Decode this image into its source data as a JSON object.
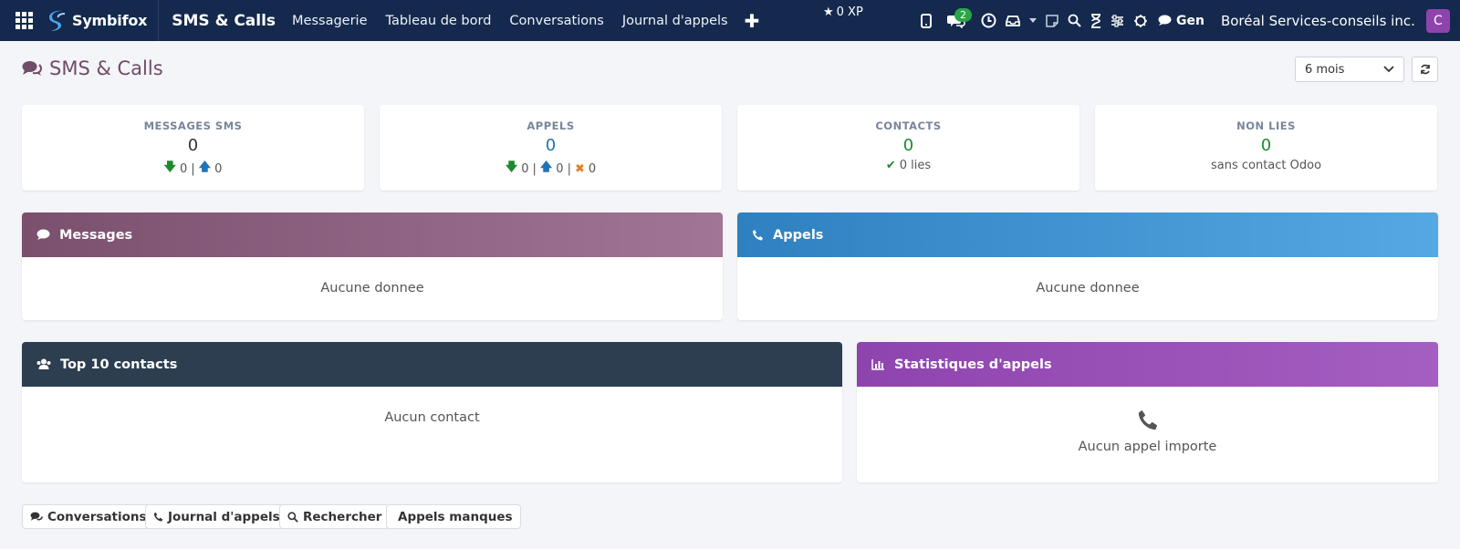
{
  "navbar": {
    "brand": "Symbifox",
    "app_title": "SMS & Calls",
    "menu": [
      "Messagerie",
      "Tableau de bord",
      "Conversations",
      "Journal d'appels"
    ],
    "xp": "0 XP",
    "chat_badge": "2",
    "gen_label": "Gen",
    "company": "Boréal Services-conseils inc.",
    "avatar_letter": "C"
  },
  "header": {
    "title": "SMS & Calls",
    "period": "6 mois"
  },
  "stats": [
    {
      "label": "MESSAGES SMS",
      "value": "0",
      "in": "0",
      "out": "0"
    },
    {
      "label": "APPELS",
      "value": "0",
      "in": "0",
      "out": "0",
      "missed": "0"
    },
    {
      "label": "CONTACTS",
      "value": "0",
      "linked": "0 lies"
    },
    {
      "label": "NON LIES",
      "value": "0",
      "sub": "sans contact Odoo"
    }
  ],
  "panels": {
    "messages": {
      "title": "Messages",
      "empty": "Aucune donnee"
    },
    "appels": {
      "title": "Appels",
      "empty": "Aucune donnee"
    },
    "top_contacts": {
      "title": "Top 10 contacts",
      "empty": "Aucun contact"
    },
    "call_stats": {
      "title": "Statistiques d'appels",
      "empty": "Aucun appel importe"
    }
  },
  "buttons": {
    "conversations": "Conversations",
    "journal": "Journal d'appels",
    "search": "Rechercher",
    "missed": "Appels manques"
  },
  "colors": {
    "navbar": "#14294d",
    "messages_gradient": [
      "#7b4f6e",
      "#a17595"
    ],
    "appels_gradient": [
      "#2f80c0",
      "#55a8e3"
    ],
    "top_contacts": "#2c3e50",
    "call_stats_gradient": [
      "#8e44ad",
      "#a55ec2"
    ],
    "green": "#1e8a2e",
    "blue": "#1f74b8",
    "orange": "#e67e22"
  }
}
